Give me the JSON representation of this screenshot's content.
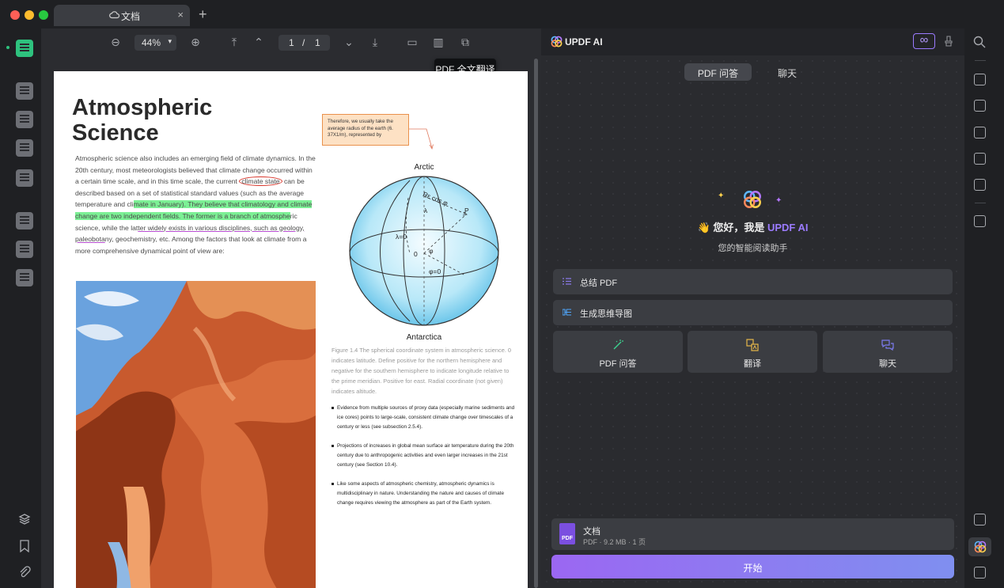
{
  "window": {
    "tab_title": "文档",
    "tab_close": "×",
    "new_tab": "+"
  },
  "toolbar": {
    "zoom": "44%",
    "zoom_arrow": "▾",
    "page_current": "1",
    "page_sep": "/",
    "page_total": "1",
    "tooltip": "PDF 全文翻译"
  },
  "document": {
    "title": "Atmospheric\nScience",
    "para": {
      "p1": "Atmospheric science also includes an emerging field of climate dynamics. In the 20th century, most meteorologists believed that climate change occurred within a certain time scale, and in this time scale, the current ",
      "p_circled": "climate state",
      "p2": " can be described based on a set of statistical standard values (such as the average temperature and cli",
      "p_hl": "mate in January). They believe that climatology and climate change are two independent fields. The former is a branch of atmosphe",
      "p3": "ric science, while the lat",
      "p_ul": "ter widely exists in various disciplines, such as geology, paleobota",
      "p4": "ny, geochemistry, etc. Among the factors that look at climate from a more comprehensive dynamical point of view are:"
    },
    "note": "Therefore, we usually take the average radius of the earth (6. 37X1/m), represented by",
    "diagram": {
      "top": "Arctic",
      "bottom": "Antarctica",
      "re_cos": "Rε cos φ",
      "lambda": "λ",
      "lambda0": "λ=0",
      "zero": "0",
      "phi": "φ",
      "phi0": "φ=0",
      "p": "P"
    },
    "caption": "Figure 1.4 The spherical coordinate system in atmospheric science. 0 indicates latitude. Define positive for the northern hemisphere and negative for the southern hemisphere to indicate longitude relative to the prime meridian. Positive for east. Radial coordinate (not given) indicates altitude.",
    "bullets": [
      "Evidence from multiple sources of proxy data (especially marine sediments and ice cores) points to large-scale, consistent climate change over timescales of a century or less (see subsection 2.5.4).",
      "Projections of increases in global mean surface air temperature during the 20th century due to anthropogenic activities and even larger increases in the 21st century (see Section 10.4).",
      "Like some aspects of atmospheric chemistry, atmospheric dynamics is multidisciplinary in nature. Understanding the nature and causes of climate change requires viewing the atmosphere as part of the Earth system."
    ]
  },
  "ai": {
    "brand": "UPDF AI",
    "infinity": "∞",
    "tabs": [
      "PDF 问答",
      "聊天"
    ],
    "greeting_prefix": "👋 您好，我是 ",
    "greeting_brand": "UPDF AI",
    "subtitle": "您的智能阅读助手",
    "actions": [
      "总结 PDF",
      "生成思维导图"
    ],
    "cards": [
      "PDF 问答",
      "翻译",
      "聊天"
    ],
    "file": {
      "name": "文档",
      "meta": "PDF · 9.2 MB · 1 页",
      "badge": "PDF"
    },
    "start": "开始"
  },
  "colors": {
    "accent": "#9b7bff",
    "highlight": "#7cf095",
    "start_from": "#9b67f2",
    "start_to": "#7f8ff0"
  }
}
